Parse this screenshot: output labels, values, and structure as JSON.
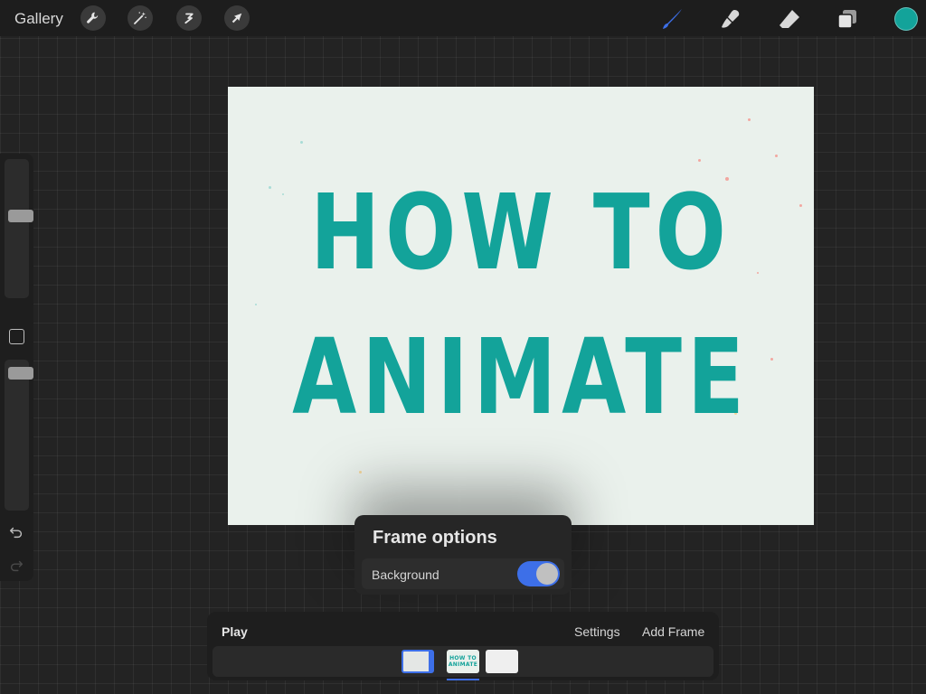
{
  "topbar": {
    "gallery_label": "Gallery",
    "tools": [
      {
        "icon": "wrench-icon",
        "name": "actions"
      },
      {
        "icon": "magic-wand-icon",
        "name": "adjustments"
      },
      {
        "icon": "selection-icon",
        "name": "selection"
      },
      {
        "icon": "arrow-cursor-icon",
        "name": "transform"
      }
    ],
    "right_tools": [
      {
        "icon": "brush-icon",
        "name": "paint",
        "active": true
      },
      {
        "icon": "smudge-icon",
        "name": "smudge"
      },
      {
        "icon": "eraser-icon",
        "name": "eraser"
      },
      {
        "icon": "layers-icon",
        "name": "layers"
      }
    ],
    "current_color": "#13a39a",
    "active_tool_color": "#3d6fe8"
  },
  "sidebar": {
    "brush_size_level": 0.6,
    "opacity_level": 0.95,
    "icons": [
      "modify-icon",
      "undo-icon",
      "redo-icon"
    ]
  },
  "canvas": {
    "background": "#eaf1ec",
    "line1": "HOW TO",
    "line2": "ANIMATE",
    "text_color": "#13a39a"
  },
  "frame_options": {
    "title": "Frame options",
    "background_label": "Background",
    "background_enabled": true,
    "toggle_color": "#3d6fe8"
  },
  "animation": {
    "play_label": "Play",
    "settings_label": "Settings",
    "add_frame_label": "Add Frame",
    "frames": [
      {
        "type": "background",
        "selected": true
      },
      {
        "type": "art",
        "text_line1": "HOW TO",
        "text_line2": "ANIMATE"
      },
      {
        "type": "blank"
      }
    ],
    "accent_color": "#3d6fe8"
  }
}
